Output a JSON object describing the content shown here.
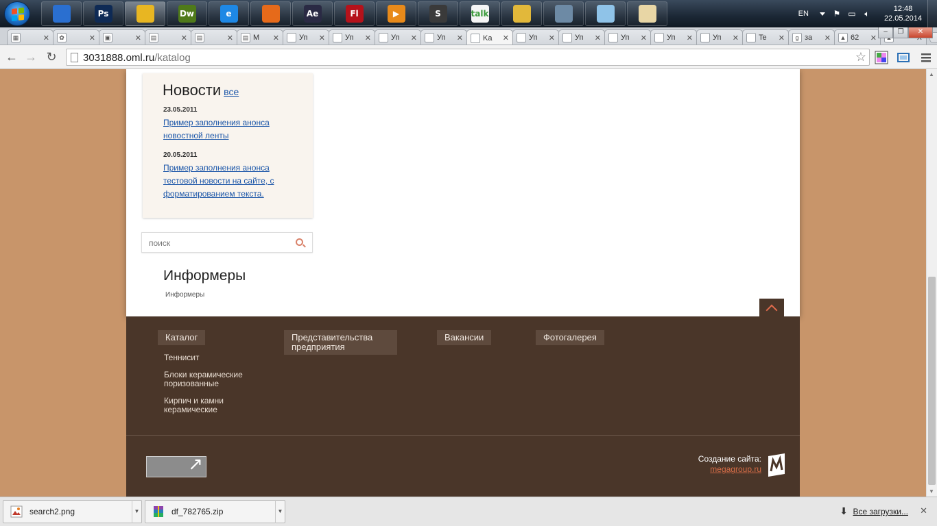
{
  "taskbar": {
    "apps": [
      {
        "name": "floppy",
        "label": "",
        "color": "#2a6fd0"
      },
      {
        "name": "photoshop",
        "label": "Ps",
        "color": "#0e2a55"
      },
      {
        "name": "chrome",
        "label": "",
        "color": "#e8b622"
      },
      {
        "name": "dreamweaver",
        "label": "Dw",
        "color": "#4f7a1a"
      },
      {
        "name": "ie",
        "label": "e",
        "color": "#1e88e5"
      },
      {
        "name": "firefox",
        "label": "",
        "color": "#e66a1a"
      },
      {
        "name": "after-effects",
        "label": "Ae",
        "color": "#2a2a44"
      },
      {
        "name": "flash",
        "label": "Fl",
        "color": "#b5121b"
      },
      {
        "name": "media-player",
        "label": "▶",
        "color": "#e88a1a"
      },
      {
        "name": "sublime",
        "label": "S",
        "color": "#3a3a3a"
      },
      {
        "name": "gtalk",
        "label": "talk",
        "color": "#f5f5f5"
      },
      {
        "name": "explorer",
        "label": "",
        "color": "#e2b83a"
      },
      {
        "name": "calculator",
        "label": "",
        "color": "#6d8aa5"
      },
      {
        "name": "notepad",
        "label": "",
        "color": "#8fc3e8"
      },
      {
        "name": "paint",
        "label": "",
        "color": "#e8d6a5"
      }
    ],
    "lang": "EN",
    "time": "12:48",
    "date": "22.05.2014"
  },
  "browser": {
    "tabs": [
      {
        "title": "",
        "fav": "▦"
      },
      {
        "title": "",
        "fav": "✿"
      },
      {
        "title": "",
        "fav": "▣"
      },
      {
        "title": "",
        "fav": "▤"
      },
      {
        "title": "",
        "fav": "▤"
      },
      {
        "title": "M",
        "fav": "▤"
      },
      {
        "title": "Уп",
        "fav": ""
      },
      {
        "title": "Уп",
        "fav": ""
      },
      {
        "title": "Уп",
        "fav": ""
      },
      {
        "title": "Уп",
        "fav": ""
      },
      {
        "title": "Ka",
        "fav": "",
        "active": true
      },
      {
        "title": "Уп",
        "fav": ""
      },
      {
        "title": "Уп",
        "fav": ""
      },
      {
        "title": "Уп",
        "fav": ""
      },
      {
        "title": "Уп",
        "fav": ""
      },
      {
        "title": "Уп",
        "fav": ""
      },
      {
        "title": "Te",
        "fav": ""
      },
      {
        "title": "за",
        "fav": "g"
      },
      {
        "title": "62",
        "fav": "▲"
      },
      {
        "title": "",
        "fav": "▲"
      }
    ],
    "url_host": "3031888.oml.ru",
    "url_path": "/katalog"
  },
  "page": {
    "news": {
      "title": "Новости",
      "all_link": "все",
      "items": [
        {
          "date": "23.05.2011",
          "text": "Пример заполнения анонса новостной ленты"
        },
        {
          "date": "20.05.2011",
          "text": "Пример заполнения анонса тестовой новости на сайте, с форматированием текста."
        }
      ]
    },
    "search": {
      "placeholder": "поиск"
    },
    "informers": {
      "title": "Информеры",
      "sub": "Информеры"
    }
  },
  "footer": {
    "columns": [
      {
        "title": "Каталог",
        "items": [
          "Теннисит",
          "Блоки керамические поризованные",
          "Кирпич и камни керамические"
        ]
      },
      {
        "title": "Представительства предприятия",
        "items": []
      },
      {
        "title": "Вакансии",
        "items": []
      },
      {
        "title": "Фотогалерея",
        "items": []
      }
    ],
    "credit_label": "Создание сайта:",
    "credit_link": "megagroup.ru"
  },
  "downloads": {
    "items": [
      {
        "name": "search2.png",
        "icon": "image-icon"
      },
      {
        "name": "df_782765.zip",
        "icon": "archive-icon"
      }
    ],
    "all_label": "Все загрузки..."
  }
}
